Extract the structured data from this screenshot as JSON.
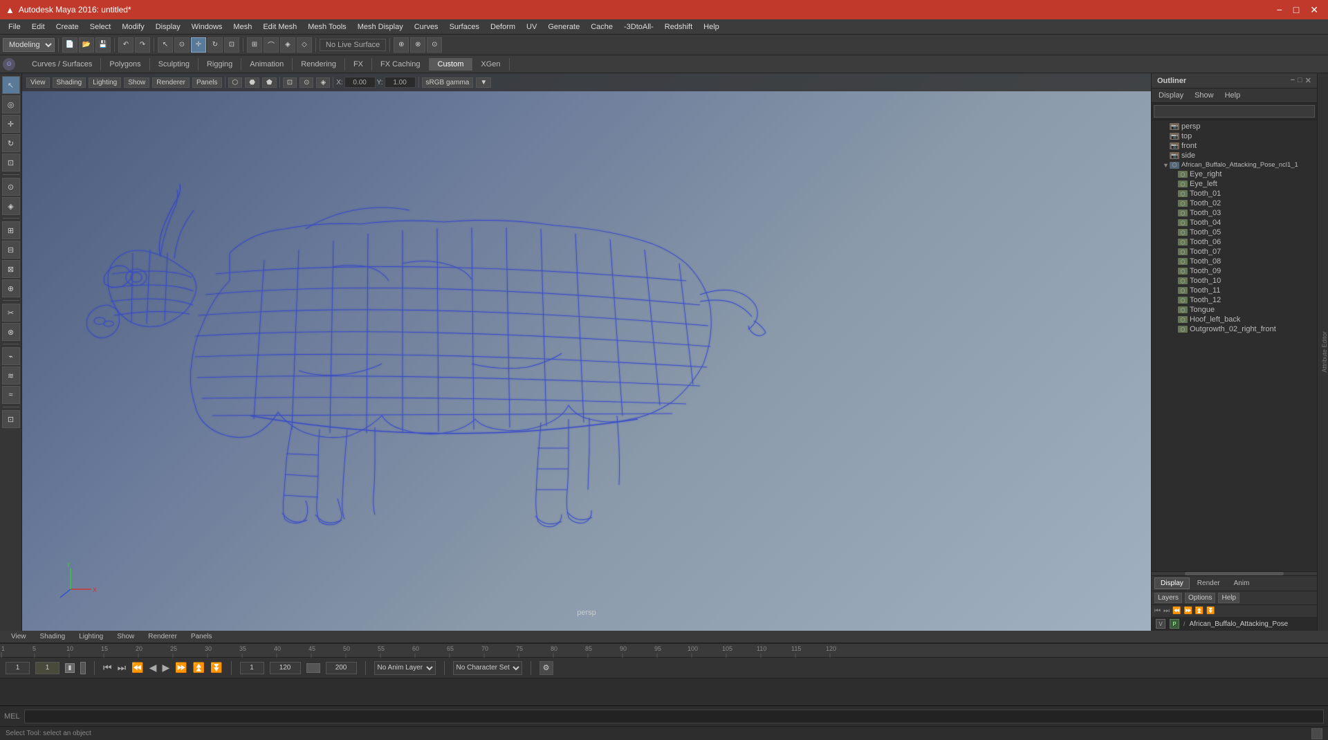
{
  "app": {
    "title": "Autodesk Maya 2016: untitled*",
    "window_controls": [
      "−",
      "□",
      "✕"
    ]
  },
  "menu": {
    "items": [
      "File",
      "Edit",
      "Create",
      "Select",
      "Modify",
      "Display",
      "Windows",
      "Mesh",
      "Edit Mesh",
      "Mesh Tools",
      "Mesh Display",
      "Curves",
      "Surfaces",
      "Deform",
      "UV",
      "Generate",
      "Cache",
      "-3DtoAll-",
      "Redshift",
      "Help"
    ]
  },
  "toolbar1": {
    "mode_select": "Modeling",
    "no_live_surface": "No Live Surface",
    "buttons": [
      "⊳",
      "⊳⊳",
      "↶",
      "↷",
      "◻",
      "◼",
      "⊡",
      "⊞",
      "◈",
      "◇",
      "⊕",
      "⊗",
      "⊙"
    ]
  },
  "tabs": {
    "items": [
      "Curves / Surfaces",
      "Polygons",
      "Sculpting",
      "Rigging",
      "Animation",
      "Rendering",
      "FX",
      "FX Caching",
      "Custom",
      "XGen"
    ],
    "active": "Custom"
  },
  "viewport": {
    "label": "persp",
    "toolbar": {
      "view_label": "View",
      "shading_label": "Shading",
      "lighting_label": "Lighting",
      "show_label": "Show",
      "renderer_label": "Renderer",
      "panels_label": "Panels",
      "coord_x": "0.00",
      "coord_y": "1.00",
      "color_space": "sRGB gamma"
    }
  },
  "outliner": {
    "title": "Outliner",
    "menu": [
      "Display",
      "Show",
      "Help"
    ],
    "search_placeholder": "",
    "items": [
      {
        "id": "persp",
        "label": "persp",
        "type": "camera",
        "indent": 0
      },
      {
        "id": "top",
        "label": "top",
        "type": "camera",
        "indent": 0
      },
      {
        "id": "front",
        "label": "front",
        "type": "camera",
        "indent": 0
      },
      {
        "id": "side",
        "label": "side",
        "type": "camera",
        "indent": 0
      },
      {
        "id": "root",
        "label": "African_Buffalo_Attacking_Pose_ncl1_1",
        "type": "group",
        "indent": 0,
        "expanded": true
      },
      {
        "id": "eye_right",
        "label": "Eye_right",
        "type": "mesh",
        "indent": 1
      },
      {
        "id": "eye_left",
        "label": "Eye_left",
        "type": "mesh",
        "indent": 1
      },
      {
        "id": "tooth01",
        "label": "Tooth_01",
        "type": "mesh",
        "indent": 1
      },
      {
        "id": "tooth02",
        "label": "Tooth_02",
        "type": "mesh",
        "indent": 1
      },
      {
        "id": "tooth03",
        "label": "Tooth_03",
        "type": "mesh",
        "indent": 1
      },
      {
        "id": "tooth04",
        "label": "Tooth_04",
        "type": "mesh",
        "indent": 1
      },
      {
        "id": "tooth05",
        "label": "Tooth_05",
        "type": "mesh",
        "indent": 1
      },
      {
        "id": "tooth06",
        "label": "Tooth_06",
        "type": "mesh",
        "indent": 1
      },
      {
        "id": "tooth07",
        "label": "Tooth_07",
        "type": "mesh",
        "indent": 1
      },
      {
        "id": "tooth08",
        "label": "Tooth_08",
        "type": "mesh",
        "indent": 1
      },
      {
        "id": "tooth09",
        "label": "Tooth_09",
        "type": "mesh",
        "indent": 1
      },
      {
        "id": "tooth10",
        "label": "Tooth_10",
        "type": "mesh",
        "indent": 1
      },
      {
        "id": "tooth11",
        "label": "Tooth_11",
        "type": "mesh",
        "indent": 1
      },
      {
        "id": "tooth12",
        "label": "Tooth_12",
        "type": "mesh",
        "indent": 1
      },
      {
        "id": "tongue",
        "label": "Tongue",
        "type": "mesh",
        "indent": 1
      },
      {
        "id": "hoof_left_back",
        "label": "Hoof_left_back",
        "type": "mesh",
        "indent": 1
      },
      {
        "id": "outgrowth",
        "label": "Outgrowth_02_right_front",
        "type": "mesh",
        "indent": 1
      }
    ],
    "tabs": [
      "Display",
      "Render",
      "Anim"
    ],
    "active_tab": "Display",
    "layers_menu": [
      "Layers",
      "Options",
      "Help"
    ],
    "layer_name": "African_Buffalo_Attacking_Pose",
    "layer_v": "V",
    "layer_p": "P"
  },
  "timeline": {
    "start": "1",
    "end": "120",
    "current": "1",
    "range_start": "1",
    "range_end": "120",
    "max": "200",
    "ticks": [
      1,
      5,
      10,
      15,
      20,
      25,
      30,
      35,
      40,
      45,
      50,
      55,
      60,
      65,
      70,
      75,
      80,
      85,
      90,
      95,
      100,
      105,
      110,
      115,
      120
    ],
    "anim_layer": "No Anim Layer",
    "char_set": "No Character Set",
    "playback_buttons": [
      "⏮",
      "⏭",
      "⏪",
      "◀",
      "▶",
      "⏩",
      "⏫",
      "⏬"
    ]
  },
  "mel": {
    "label": "MEL",
    "placeholder": ""
  },
  "status_bar": {
    "text": "Select Tool: select an object"
  },
  "colors": {
    "title_bar_bg": "#c0392b",
    "wireframe": "#2233aa",
    "viewport_bg_top": "#6a7a9a",
    "viewport_bg_bottom": "#8a9aaa",
    "accent": "#5a7a9a"
  }
}
